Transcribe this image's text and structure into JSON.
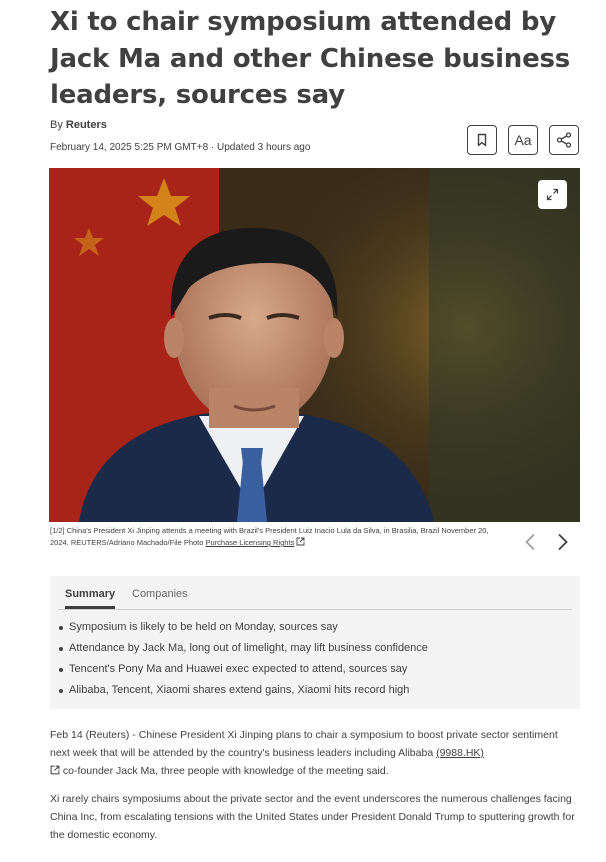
{
  "article": {
    "headline": "Xi to chair symposium attended by Jack Ma and other Chinese business leaders, sources say",
    "byline_prefix": "By",
    "byline_author": "Reuters",
    "dateline": "February 14, 2025 5:25 PM GMT+8 · Updated 3 hours ago",
    "toolbar": {
      "bookmark_icon": "bookmark-icon",
      "text_size_label": "Aa",
      "share_icon": "share-icon"
    },
    "photo": {
      "expand_icon": "expand-icon",
      "caption_counter": "[1/2]",
      "caption_text": "China's President Xi Jinping attends a meeting with Brazil's President Luiz Inacio Lula da Silva, in Brasilia, Brazil November 20, 2024. REUTERS/Adriano Machado/File Photo",
      "licensing_link": "Purchase Licensing Rights"
    },
    "summary": {
      "tabs": [
        "Summary",
        "Companies"
      ],
      "bullets": [
        "Symposium is likely to be held on Monday, sources say",
        "Attendance by Jack Ma, long out of limelight, may lift business confidence",
        "Tencent's Pony Ma and Huawei exec expected to attend, sources say",
        "Alibaba, Tencent, Xiaomi shares extend gains, Xiaomi hits record high"
      ]
    },
    "body": {
      "p1_before_ticker": "Feb 14 (Reuters) - Chinese President Xi Jinping plans to chair a symposium to boost private sector sentiment next week that will be attended by the country's business leaders including Alibaba ",
      "p1_ticker": "(9988.HK)",
      "p1_after_ticker": " co-founder Jack Ma, three people with knowledge of the meeting said.",
      "p2": "Xi rarely chairs symposiums about the private sector and the event underscores the numerous challenges facing China Inc, from escalating tensions with the United States under President Donald Trump to sputtering growth for the domestic economy."
    }
  },
  "colors": {
    "text": "#404040",
    "summary_bg": "#f4f4f4",
    "photo_flag_red": "#b8221a",
    "suit_navy": "#1c2a4a"
  }
}
